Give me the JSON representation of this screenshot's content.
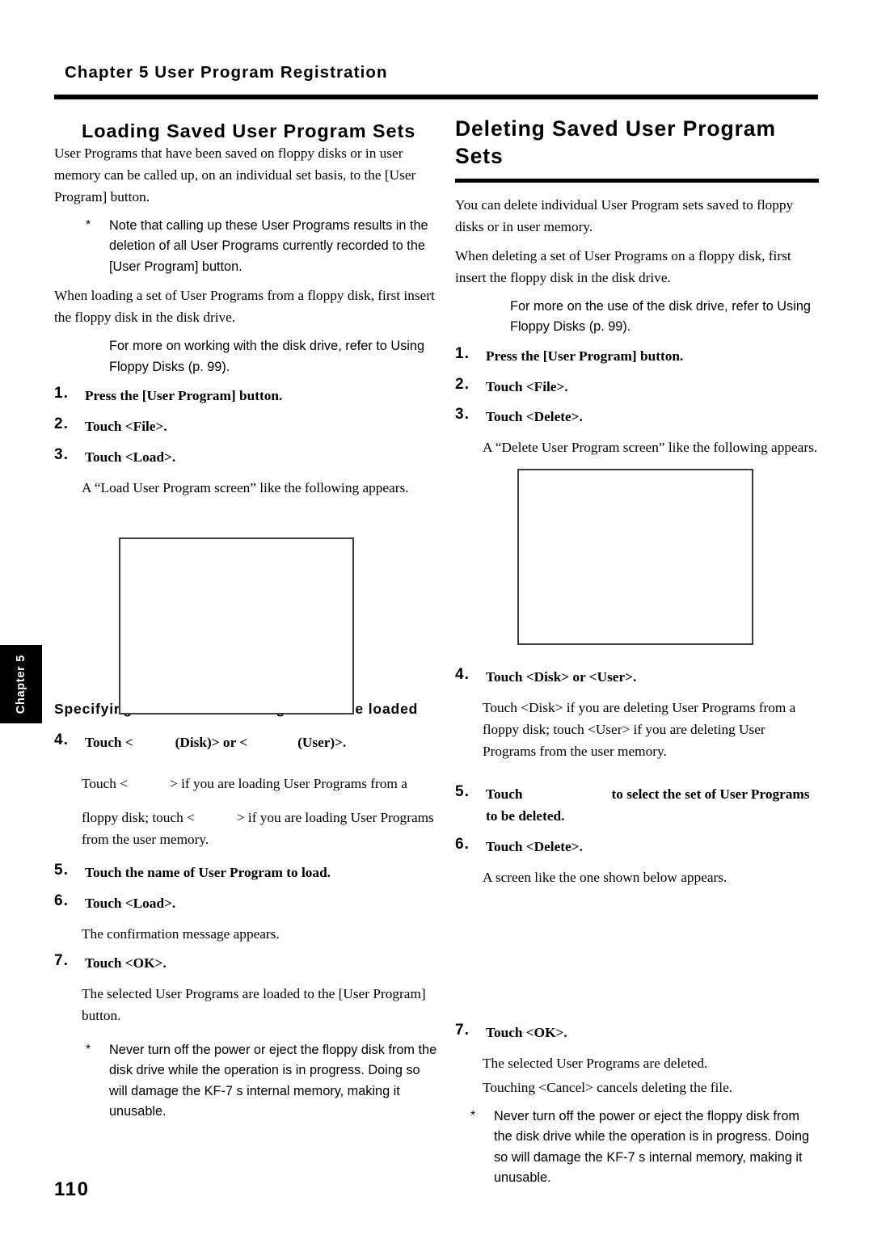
{
  "header": {
    "chapter_title": "Chapter 5 User Program Registration"
  },
  "chapter_tab": {
    "label": "Chapter 5"
  },
  "folio": {
    "page_number": "110"
  },
  "left_column": {
    "heading": "Loading Saved User Program Sets",
    "intro": "User Programs that have been saved on floppy disks or in user memory can be called up, on an individual set basis, to the [User Program] button.",
    "note_star": "*",
    "note_1": "Note that calling up these User Programs results in the deletion of all User Programs currently recorded to the [User Program] button.",
    "para_2": "When loading a set of User Programs from a floppy disk, first insert the floppy disk in the disk drive.",
    "note_2": "For more on working with the disk drive, refer to  Using Floppy Disks  (p. 99).",
    "steps_a": [
      {
        "num": "1.",
        "text": "Press the [User Program] button."
      },
      {
        "num": "2.",
        "text": "Touch <File>."
      },
      {
        "num": "3.",
        "text": "Touch <Load>."
      }
    ],
    "after_step3": "A “Load User Program screen” like the following appears.",
    "subheading": "Specifying the set of User Programs to be loaded",
    "step_4": {
      "num": "4.",
      "part_1": "Touch <",
      "part_2": "(Disk)> or <",
      "part_3": "(User)>."
    },
    "step_4_body_1": "Touch <",
    "step_4_body_2": "> if you are loading User Programs from a",
    "step_4_body_3": "floppy disk; touch <",
    "step_4_body_4": "> if you are loading User",
    "step_4_body_5": "Programs from the user memory.",
    "steps_b": [
      {
        "num": "5.",
        "text": "Touch the name of User Program to load."
      },
      {
        "num": "6.",
        "text": "Touch <Load>."
      }
    ],
    "after_step6": "The confirmation message appears.",
    "step_7": {
      "num": "7.",
      "text": "Touch <OK>."
    },
    "after_step7": "The selected User Programs are loaded to the [User Program] button.",
    "warning_star": "*",
    "warning": "Never turn off the power or eject the floppy disk from the disk drive while the operation is in progress. Doing so will damage the KF-7 s internal memory, making it unusable."
  },
  "right_column": {
    "heading": "Deleting Saved User Program Sets",
    "intro": "You can delete individual User Program sets saved to floppy disks or in user memory.",
    "para_2": "When deleting a set of User Programs on a floppy disk, first insert the floppy disk in the disk drive.",
    "note_1": "For more on the use of the disk drive, refer to  Using Floppy Disks  (p. 99).",
    "steps_a": [
      {
        "num": "1.",
        "text": "Press the [User Program] button."
      },
      {
        "num": "2.",
        "text": "Touch <File>."
      },
      {
        "num": "3.",
        "text": "Touch <Delete>."
      }
    ],
    "after_step3": "A “Delete User Program screen” like the following appears.",
    "step_4": {
      "num": "4.",
      "text": "Touch <Disk> or <User>."
    },
    "step_4_body": "Touch <Disk> if you are deleting User Programs from a floppy disk; touch <User> if you are deleting User Programs from the user memory.",
    "step_5": {
      "num": "5.",
      "part_1": "Touch",
      "part_2": "to select the set of User Programs to be deleted."
    },
    "step_6": {
      "num": "6.",
      "text": "Touch <Delete>."
    },
    "after_step6": "A screen like the one shown below appears.",
    "step_7": {
      "num": "7.",
      "text": "Touch <OK>."
    },
    "after_step7_a": "The selected User Programs are deleted.",
    "after_step7_b": "Touching <Cancel> cancels deleting the file.",
    "warning_star": "*",
    "warning": "Never turn off the power or eject the floppy disk from the disk drive while the operation is in progress. Doing so will damage the KF-7 s internal memory, making it unusable."
  }
}
